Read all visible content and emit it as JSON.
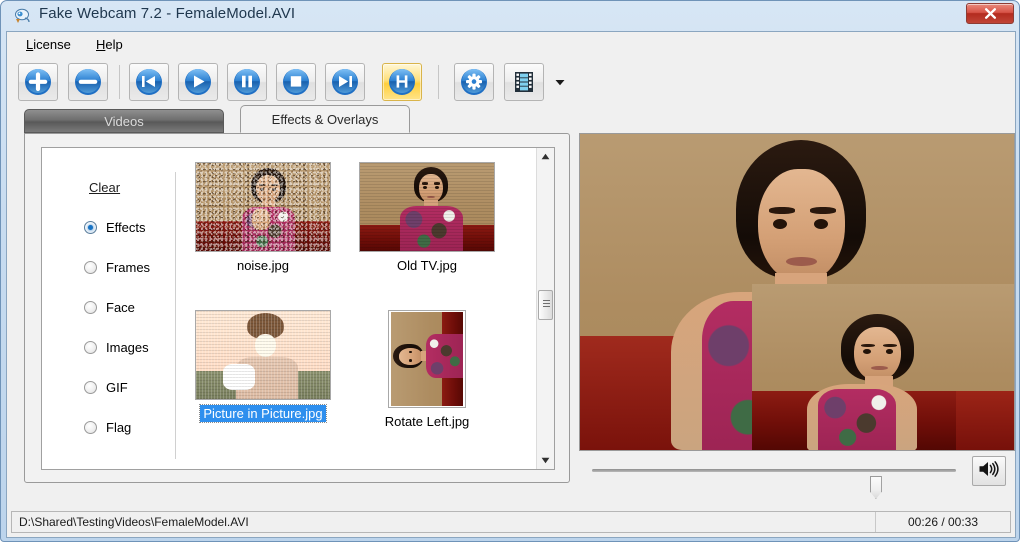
{
  "window": {
    "title": "Fake Webcam 7.2 - FemaleModel.AVI",
    "app_icon": "webcam-icon",
    "close_label": "x",
    "accent_color": "#2e8fee",
    "active_tool_color": "#ffcf3c"
  },
  "menubar": {
    "items": [
      {
        "label": "License",
        "mnemonic": "L"
      },
      {
        "label": "Help",
        "mnemonic": "H"
      }
    ]
  },
  "toolbar": {
    "buttons": [
      {
        "name": "add-button",
        "icon": "plus-icon",
        "active": false
      },
      {
        "name": "remove-button",
        "icon": "minus-icon",
        "active": false
      },
      {
        "name": "previous-button",
        "icon": "skip-back-icon",
        "active": false
      },
      {
        "name": "play-button",
        "icon": "play-icon",
        "active": false
      },
      {
        "name": "pause-button",
        "icon": "pause-icon",
        "active": false
      },
      {
        "name": "stop-button",
        "icon": "stop-icon",
        "active": false
      },
      {
        "name": "next-button",
        "icon": "skip-next-icon",
        "active": false
      },
      {
        "name": "webcam-output-button",
        "icon": "webcam-icon",
        "active": true
      },
      {
        "name": "settings-button",
        "icon": "gear-icon",
        "active": false
      },
      {
        "name": "film-button",
        "icon": "film-strip-icon",
        "active": false
      }
    ],
    "dropdown_icon": "chevron-down-icon"
  },
  "tabs": [
    {
      "label": "Videos",
      "active": false
    },
    {
      "label": "Effects & Overlays",
      "active": true
    }
  ],
  "effects_panel": {
    "clear_label": "Clear",
    "categories": [
      {
        "label": "Effects",
        "checked": true
      },
      {
        "label": "Frames",
        "checked": false
      },
      {
        "label": "Face",
        "checked": false
      },
      {
        "label": "Images",
        "checked": false
      },
      {
        "label": "GIF",
        "checked": false
      },
      {
        "label": "Flag",
        "checked": false
      }
    ],
    "thumbnails": [
      {
        "caption": "noise.jpg",
        "selected": false,
        "style": "noise"
      },
      {
        "caption": "Old TV.jpg",
        "selected": false,
        "style": "oldtv"
      },
      {
        "caption": "Picture in Picture.jpg",
        "selected": true,
        "style": "pip"
      },
      {
        "caption": "Rotate Left.jpg",
        "selected": false,
        "style": "rotate"
      }
    ],
    "scrollbar": {
      "up_icon": "triangle-up-icon",
      "down_icon": "triangle-down-icon"
    }
  },
  "preview": {
    "effect_applied": "Picture in Picture",
    "wall_color": "#b08e63",
    "couch_color": "#7a0f0a",
    "seek_position_percent": 78,
    "volume_icon": "speaker-icon"
  },
  "statusbar": {
    "path": "D:\\Shared\\TestingVideos\\FemaleModel.AVI",
    "time": "00:26 / 00:33"
  }
}
